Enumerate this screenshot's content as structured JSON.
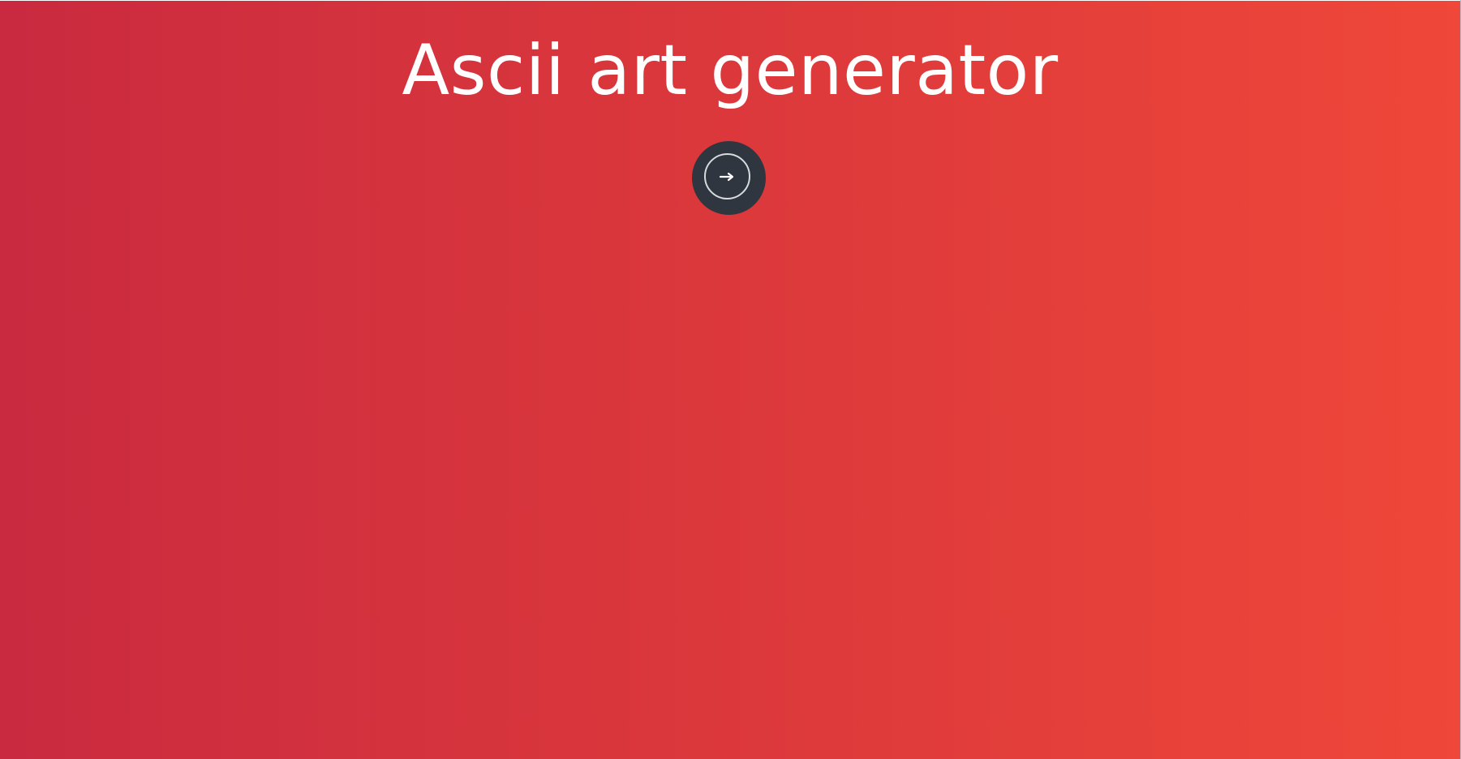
{
  "page": {
    "title": "Ascii art generator"
  },
  "start_button": {
    "icon": "arrow-right-icon"
  },
  "colors": {
    "gradient_start": "#c92a3f",
    "gradient_end": "#ef4739",
    "button_bg": "#2f3640",
    "title_text": "#ffffff"
  }
}
